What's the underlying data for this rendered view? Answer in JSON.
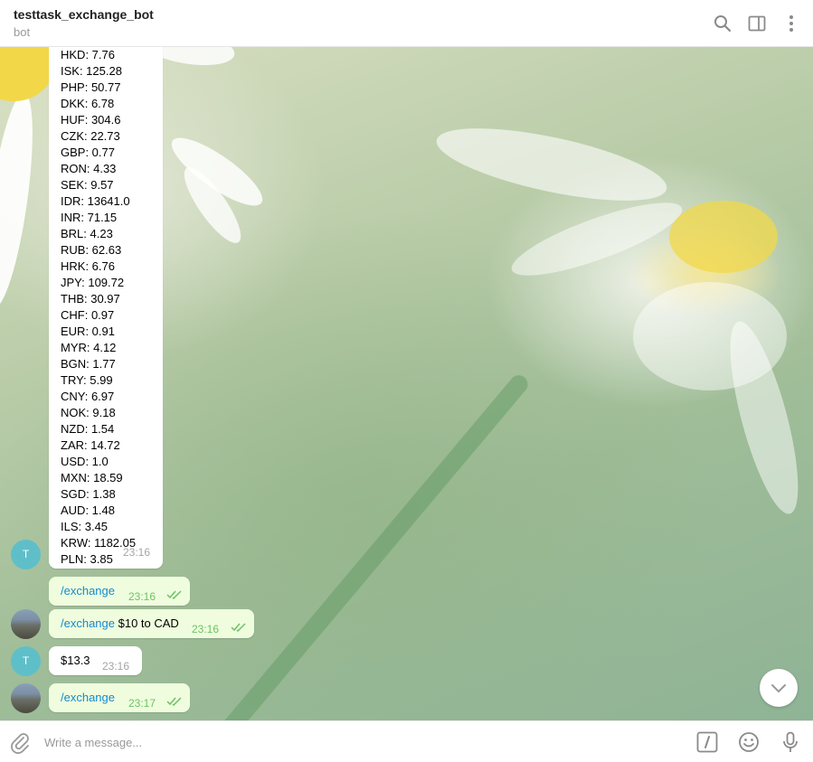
{
  "header": {
    "title": "testtask_exchange_bot",
    "subtitle": "bot",
    "icons": [
      "search-icon",
      "sidebar-toggle-icon",
      "more-vertical-icon"
    ]
  },
  "rates_message": {
    "lines": [
      "HKD: 7.76",
      "ISK: 125.28",
      "PHP: 50.77",
      "DKK: 6.78",
      "HUF: 304.6",
      "CZK: 22.73",
      "GBP: 0.77",
      "RON: 4.33",
      "SEK: 9.57",
      "IDR: 13641.0",
      "INR: 71.15",
      "BRL: 4.23",
      "RUB: 62.63",
      "HRK: 6.76",
      "JPY: 109.72",
      "THB: 30.97",
      "CHF: 0.97",
      "EUR: 0.91",
      "MYR: 4.12",
      "BGN: 1.77",
      "TRY: 5.99",
      "CNY: 6.97",
      "NOK: 9.18",
      "NZD: 1.54",
      "ZAR: 14.72",
      "USD: 1.0",
      "MXN: 18.59",
      "SGD: 1.38",
      "AUD: 1.48",
      "ILS: 3.45",
      "KRW: 1182.05",
      "PLN: 3.85"
    ],
    "time": "23:16",
    "avatar_letter": "T"
  },
  "messages": [
    {
      "command": "/exchange",
      "text": "",
      "time": "23:16"
    },
    {
      "command": "/exchange",
      "text": " $10 to CAD",
      "time": "23:16"
    },
    {
      "text": "$13.3",
      "time": "23:16",
      "avatar_letter": "T"
    },
    {
      "command": "/exchange",
      "text": "",
      "time": "23:17"
    }
  ],
  "composer": {
    "placeholder": "Write a message...",
    "icons": [
      "attach-icon",
      "bot-commands-icon",
      "emoji-icon",
      "microphone-icon"
    ]
  },
  "colors": {
    "link": "#168acd",
    "outgoing_bubble": "#effdde",
    "read_tick": "#6cc264",
    "bot_avatar": "#5fbfc9"
  }
}
